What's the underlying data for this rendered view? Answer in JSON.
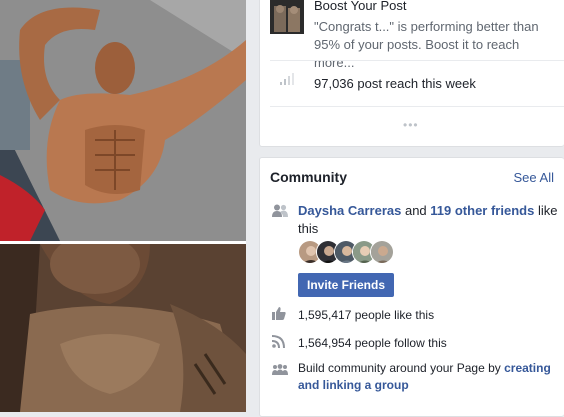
{
  "boost": {
    "title": "Boost Your Post",
    "text": "\"Congrats t...\" is performing better than 95% of your posts. Boost it to reach more..."
  },
  "reach": {
    "text": "97,036 post reach this week"
  },
  "more_dots": "•••",
  "community": {
    "title": "Community",
    "see_all": "See All",
    "friend_name": "Daysha Carreras",
    "and_text": " and ",
    "others_link": "119 other friends",
    "like_this": " like this",
    "invite_label": "Invite Friends",
    "likes_text": "1,595,417 people like this",
    "follows_text": "1,564,954 people follow this",
    "build_prefix": "Build community around your Page by ",
    "build_link": "creating and linking a group"
  },
  "colors": {
    "link": "#365899",
    "button": "#4267b2",
    "page_bg": "#e9ebee"
  }
}
